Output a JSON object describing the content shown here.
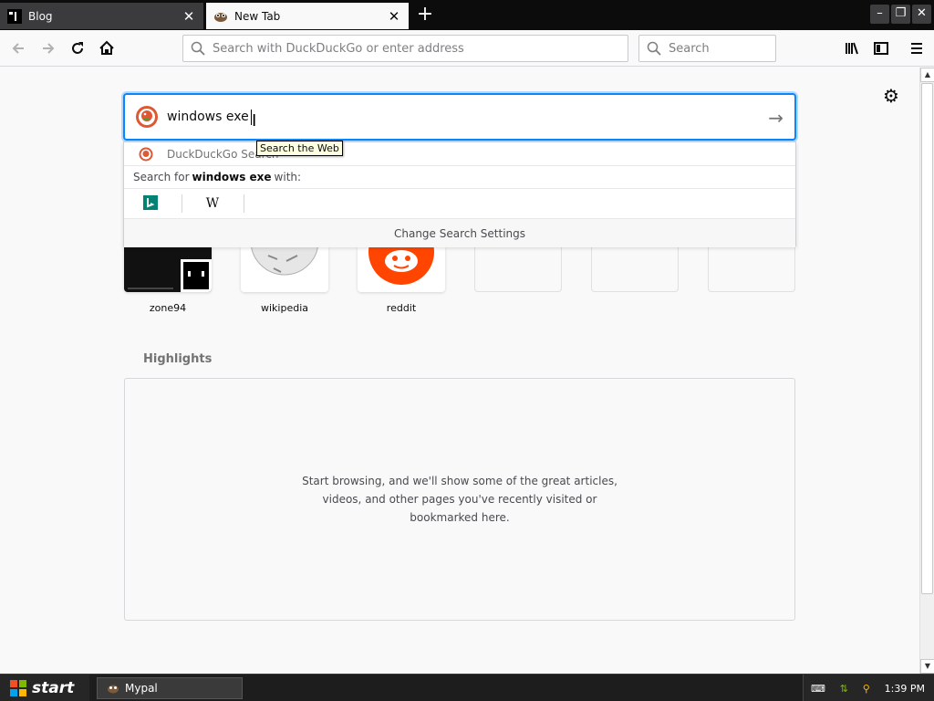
{
  "tabs": [
    {
      "label": "Blog",
      "active": false
    },
    {
      "label": "New Tab",
      "active": true
    }
  ],
  "toolbar": {
    "url_placeholder": "Search with DuckDuckGo or enter address",
    "search_placeholder": "Search"
  },
  "search": {
    "query": "windows exe",
    "tooltip": "Search the Web"
  },
  "suggestions": {
    "first_row": "DuckDuckGo Search",
    "search_for_prefix": "Search for",
    "search_for_query": "windows exe",
    "search_for_suffix": "with:",
    "engines": [
      {
        "name": "bing-icon",
        "glyph": ""
      },
      {
        "name": "wikipedia-icon",
        "glyph": "W"
      }
    ],
    "change_settings": "Change Search Settings"
  },
  "top_sites": [
    {
      "label": "zone94"
    },
    {
      "label": "wikipedia"
    },
    {
      "label": "reddit"
    },
    {
      "label": ""
    },
    {
      "label": ""
    },
    {
      "label": ""
    }
  ],
  "highlights": {
    "title": "Highlights",
    "empty_message": "Start browsing, and we'll show some of the great articles, videos, and other pages you've recently visited or bookmarked here."
  },
  "taskbar": {
    "start_label": "start",
    "window_label": "Mypal",
    "clock": "1:39 PM"
  },
  "colors": {
    "accent": "#0a84ff",
    "reddit": "#ff4500",
    "bing": "#008373",
    "ddg": "#de5833"
  }
}
